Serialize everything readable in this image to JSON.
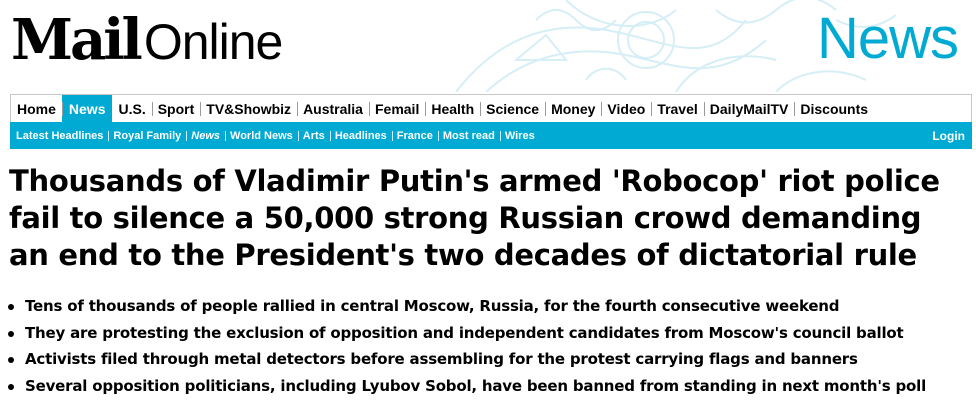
{
  "brand": {
    "logo_mail": "Mail",
    "logo_online": "Online",
    "section": "News",
    "accent": "#00aad2"
  },
  "nav": {
    "primary": [
      "Home",
      "News",
      "U.S.",
      "Sport",
      "TV&Showbiz",
      "Australia",
      "Femail",
      "Health",
      "Science",
      "Money",
      "Video",
      "Travel",
      "DailyMailTV",
      "Discounts"
    ],
    "active": "News",
    "secondary": [
      "Latest Headlines",
      "Royal Family",
      "News",
      "World News",
      "Arts",
      "Headlines",
      "France",
      "Most read",
      "Wires"
    ],
    "secondary_current": "News",
    "login": "Login"
  },
  "article": {
    "headline": "Thousands of Vladimir Putin's armed 'Robocop' riot police fail to silence a 50,000 strong Russian crowd demanding an end to the President's two decades of dictatorial rule",
    "bullets": [
      "Tens of thousands of people rallied in central Moscow, Russia, for the fourth consecutive weekend",
      "They are protesting the exclusion of opposition and independent candidates from Moscow's council ballot",
      "Activists filed through metal detectors before assembling for the protest carrying flags and banners",
      "Several opposition politicians, including Lyubov Sobol, have been banned from standing in next month's poll"
    ]
  }
}
